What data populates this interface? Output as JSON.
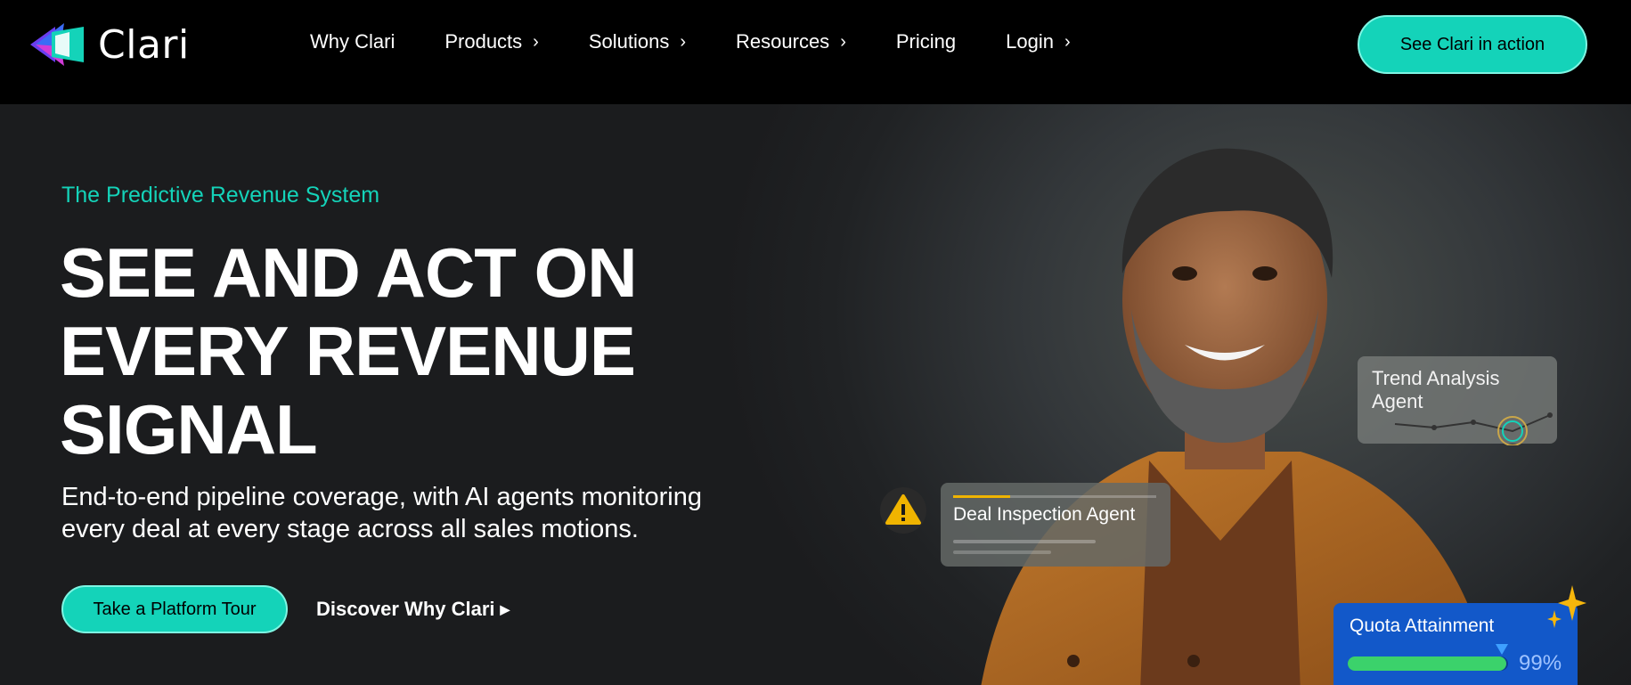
{
  "nav": {
    "logo_text": "Clari",
    "items": [
      {
        "label": "Why Clari",
        "has_chevron": false
      },
      {
        "label": "Products",
        "has_chevron": true
      },
      {
        "label": "Solutions",
        "has_chevron": true
      },
      {
        "label": "Resources",
        "has_chevron": true
      },
      {
        "label": "Pricing",
        "has_chevron": false
      },
      {
        "label": "Login",
        "has_chevron": true
      }
    ],
    "cta_label": "See Clari in action"
  },
  "hero": {
    "eyebrow": "The Predictive Revenue System",
    "headline_lines": [
      "SEE AND ACT ON",
      "EVERY REVENUE",
      "SIGNAL"
    ],
    "sub_lines": [
      "End-to-end pipeline coverage, with AI agents monitoring",
      "every deal at every stage across all sales motions."
    ],
    "primary_button": "Take a Platform Tour",
    "secondary_link": "Discover Why Clari"
  },
  "cards": {
    "trend": {
      "line1": "Trend Analysis",
      "line2": "Agent"
    },
    "deal": {
      "label": "Deal Inspection Agent"
    },
    "quota": {
      "label": "Quota Attainment",
      "percent_text": "99%",
      "fill_fraction": 0.99
    }
  },
  "colors": {
    "accent": "#14d3b9",
    "warning": "#f0b400",
    "quota_blue": "#1258c9",
    "quota_green": "#3bd26b"
  },
  "icons": [
    "clari-logo-icon",
    "chevron-right-icon",
    "triangle-right-icon",
    "warning-icon",
    "sparkle-icon"
  ]
}
